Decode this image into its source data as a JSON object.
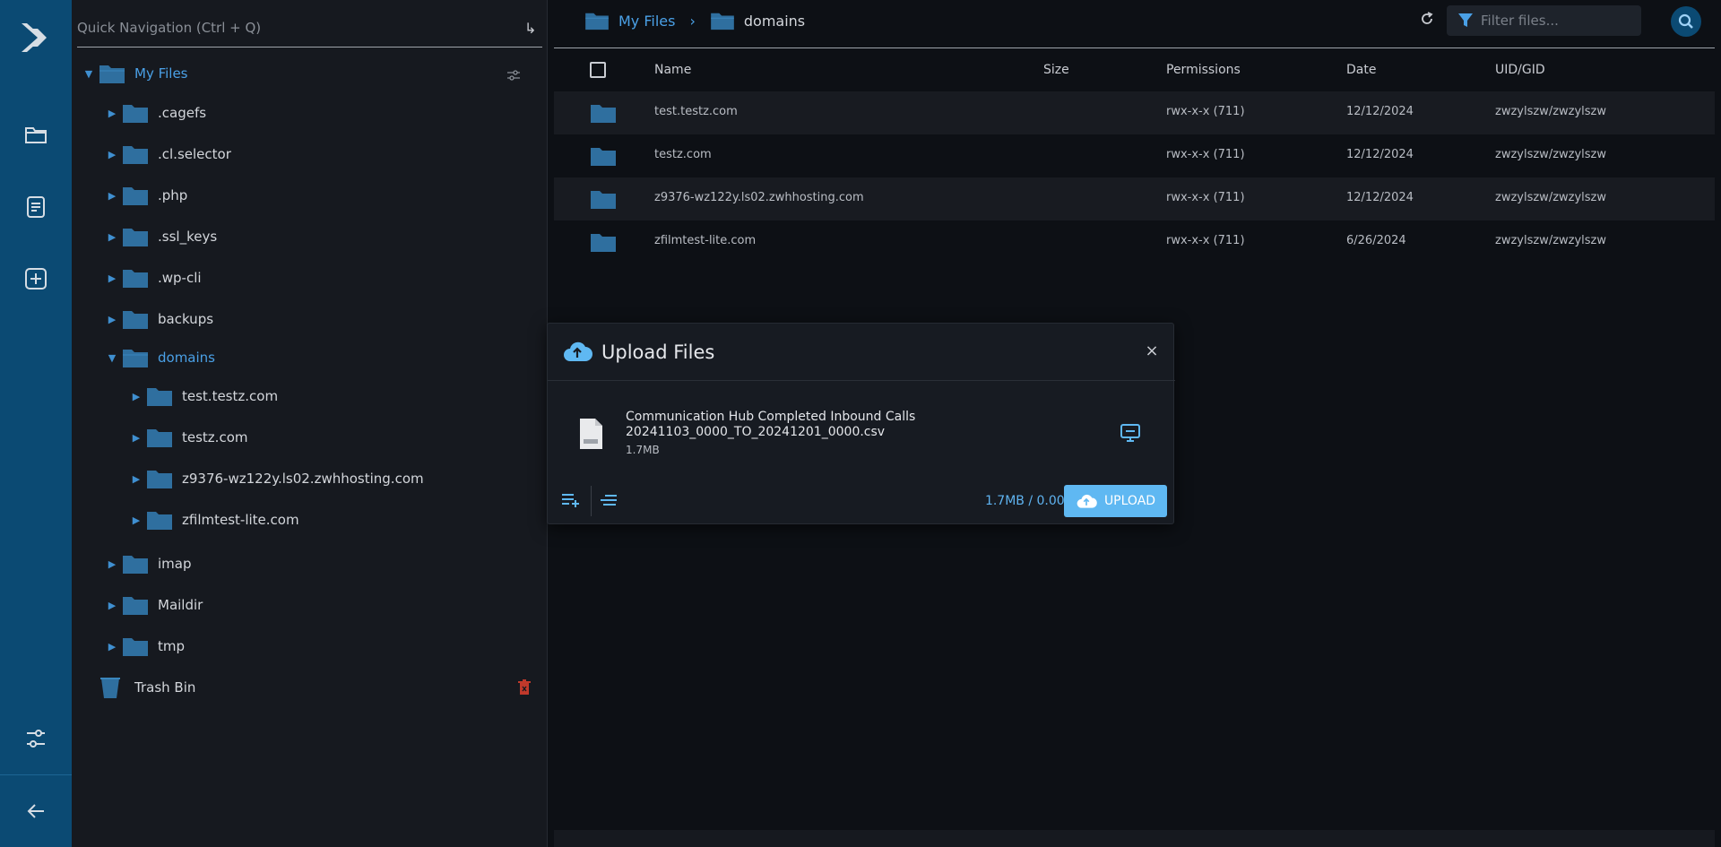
{
  "quick_nav": {
    "placeholder": "Quick Navigation (Ctrl + Q)"
  },
  "tree": {
    "root": "My Files",
    "items": [
      {
        "label": ".cagefs"
      },
      {
        "label": ".cl.selector"
      },
      {
        "label": ".php"
      },
      {
        "label": ".ssl_keys"
      },
      {
        "label": ".wp-cli"
      },
      {
        "label": "backups"
      },
      {
        "label": "domains"
      },
      {
        "label": "test.testz.com"
      },
      {
        "label": "testz.com"
      },
      {
        "label": "z9376-wz122y.ls02.zwhhosting.com"
      },
      {
        "label": "zfilmtest-lite.com"
      },
      {
        "label": "imap"
      },
      {
        "label": "Maildir"
      },
      {
        "label": "tmp"
      }
    ],
    "trash": "Trash Bin"
  },
  "breadcrumb": {
    "root": "My Files",
    "current": "domains"
  },
  "filter": {
    "placeholder": "Filter files..."
  },
  "table": {
    "headers": {
      "name": "Name",
      "size": "Size",
      "permissions": "Permissions",
      "date": "Date",
      "uid": "UID/GID"
    },
    "rows": [
      {
        "name": "test.testz.com",
        "size": "",
        "permissions": "rwx-x-x (711)",
        "date": "12/12/2024",
        "uid": "zwzylszw/zwzylszw"
      },
      {
        "name": "testz.com",
        "size": "",
        "permissions": "rwx-x-x (711)",
        "date": "12/12/2024",
        "uid": "zwzylszw/zwzylszw"
      },
      {
        "name": "z9376-wz122y.ls02.zwhhosting.com",
        "size": "",
        "permissions": "rwx-x-x (711)",
        "date": "12/12/2024",
        "uid": "zwzylszw/zwzylszw"
      },
      {
        "name": "zfilmtest-lite.com",
        "size": "",
        "permissions": "rwx-x-x (711)",
        "date": "6/26/2024",
        "uid": "zwzylszw/zwzylszw"
      }
    ]
  },
  "upload_dialog": {
    "title": "Upload Files",
    "close": "×",
    "file": {
      "name_line1": "Communication Hub Completed Inbound Calls",
      "name_line2": "20241103_0000_TO_20241201_0000.csv",
      "size": "1.7MB"
    },
    "progress": "1.7MB / 0.00%",
    "upload_label": "UPLOAD"
  },
  "colors": {
    "rail": "#0b4a73",
    "accent": "#4aa0e6",
    "folder": "#2f6f9f",
    "upload_button": "#5fb8f2",
    "trash_delete": "#c0392b"
  }
}
